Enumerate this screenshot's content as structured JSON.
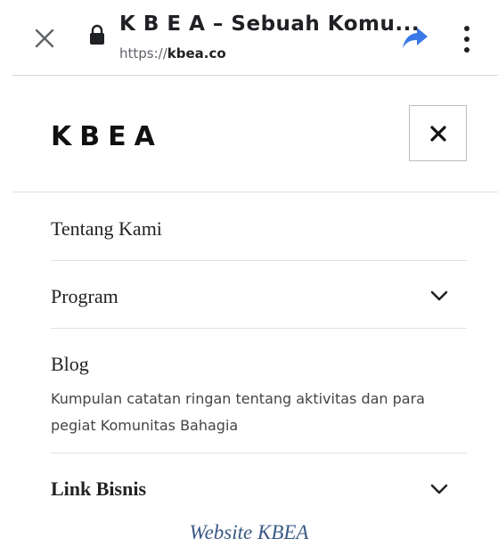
{
  "browser": {
    "tab_title": "K B E A – Sebuah Komu...",
    "url_prefix": "https://",
    "url_domain": "kbea.co",
    "icons": {
      "close": "close-icon",
      "lock": "lock-icon",
      "share": "share-icon",
      "menu": "more-vert-icon"
    },
    "share_color": "#3b78e7"
  },
  "site": {
    "logo": "KBEA",
    "close_label": "✕"
  },
  "menu": {
    "items": [
      {
        "label": "Tentang Kami",
        "has_submenu": false
      },
      {
        "label": "Program",
        "has_submenu": true
      },
      {
        "label": "Blog",
        "has_submenu": false,
        "description": "Kumpulan catatan ringan tentang aktivitas dan para pegiat Komunitas Bahagia"
      },
      {
        "label": "Link Bisnis",
        "has_submenu": true
      }
    ]
  },
  "caption": "Website KBEA"
}
